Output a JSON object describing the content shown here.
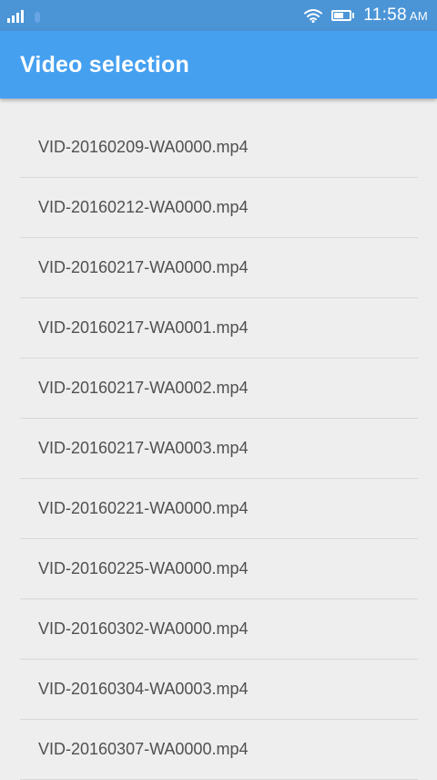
{
  "status_bar": {
    "time": "11:58",
    "ampm": "AM",
    "signal_icon": "signal-bars-icon",
    "wifi_icon": "wifi-icon",
    "battery_icon": "battery-icon",
    "battery_level": 0.6,
    "color": "#4b95d7"
  },
  "app_bar": {
    "title": "Video selection",
    "color": "#45a0f0"
  },
  "videos": [
    {
      "name": "VID-20160209-WA0000.mp4"
    },
    {
      "name": "VID-20160212-WA0000.mp4"
    },
    {
      "name": "VID-20160217-WA0000.mp4"
    },
    {
      "name": "VID-20160217-WA0001.mp4"
    },
    {
      "name": "VID-20160217-WA0002.mp4"
    },
    {
      "name": "VID-20160217-WA0003.mp4"
    },
    {
      "name": "VID-20160221-WA0000.mp4"
    },
    {
      "name": "VID-20160225-WA0000.mp4"
    },
    {
      "name": "VID-20160302-WA0000.mp4"
    },
    {
      "name": "VID-20160304-WA0003.mp4"
    },
    {
      "name": "VID-20160307-WA0000.mp4"
    }
  ]
}
